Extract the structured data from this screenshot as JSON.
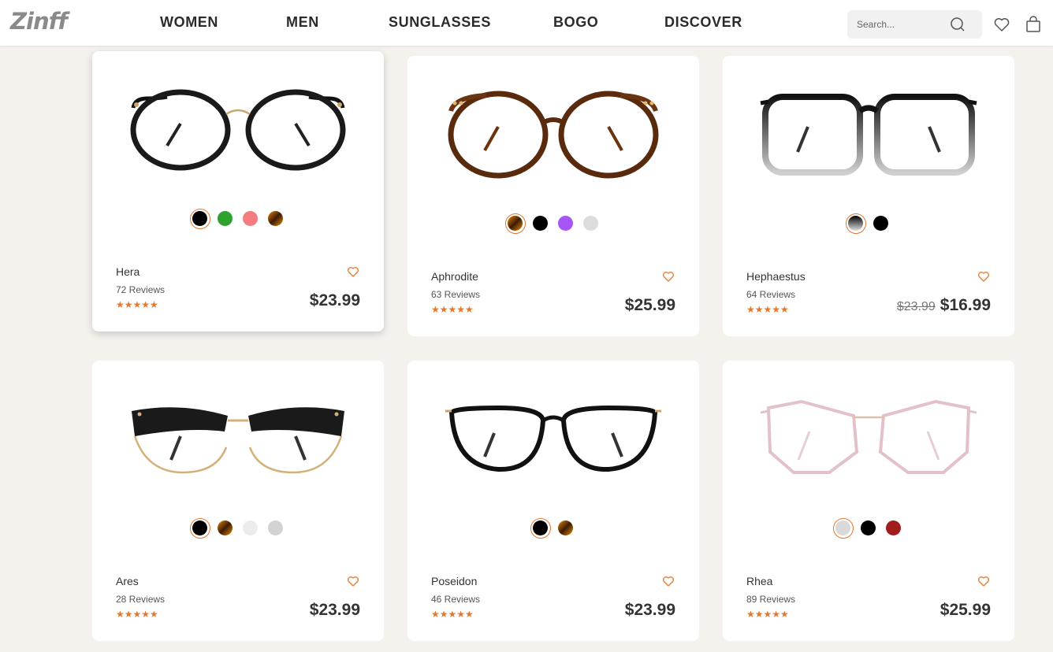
{
  "header": {
    "logo": "Zinff",
    "nav": [
      "WOMEN",
      "MEN",
      "SUNGLASSES",
      "BOGO",
      "DISCOVER"
    ],
    "search_placeholder": "Search..."
  },
  "colors": {
    "accent": "#e8772e"
  },
  "products": [
    {
      "name": "Hera",
      "reviews": "72 Reviews",
      "price": "$23.99",
      "old_price": "",
      "swatches": [
        "black",
        "green",
        "pink",
        "tortoise"
      ],
      "selected": 0,
      "stars": 5
    },
    {
      "name": "Aphrodite",
      "reviews": "63 Reviews",
      "price": "$25.99",
      "old_price": "",
      "swatches": [
        "tortoise",
        "black",
        "purple",
        "clear-gray"
      ],
      "selected": 0,
      "stars": 5
    },
    {
      "name": "Hephaestus",
      "reviews": "64 Reviews",
      "price": "$16.99",
      "old_price": "$23.99",
      "swatches": [
        "black-clear-gradient",
        "black"
      ],
      "selected": 0,
      "stars": 5
    },
    {
      "name": "Ares",
      "reviews": "28 Reviews",
      "price": "$23.99",
      "old_price": "",
      "swatches": [
        "black",
        "tortoise",
        "clear",
        "gray"
      ],
      "selected": 0,
      "stars": 5
    },
    {
      "name": "Poseidon",
      "reviews": "46 Reviews",
      "price": "$23.99",
      "old_price": "",
      "swatches": [
        "black",
        "tortoise"
      ],
      "selected": 0,
      "stars": 5
    },
    {
      "name": "Rhea",
      "reviews": "89 Reviews",
      "price": "$25.99",
      "old_price": "",
      "swatches": [
        "clear-gray",
        "black",
        "red"
      ],
      "selected": 0,
      "stars": 5
    }
  ]
}
